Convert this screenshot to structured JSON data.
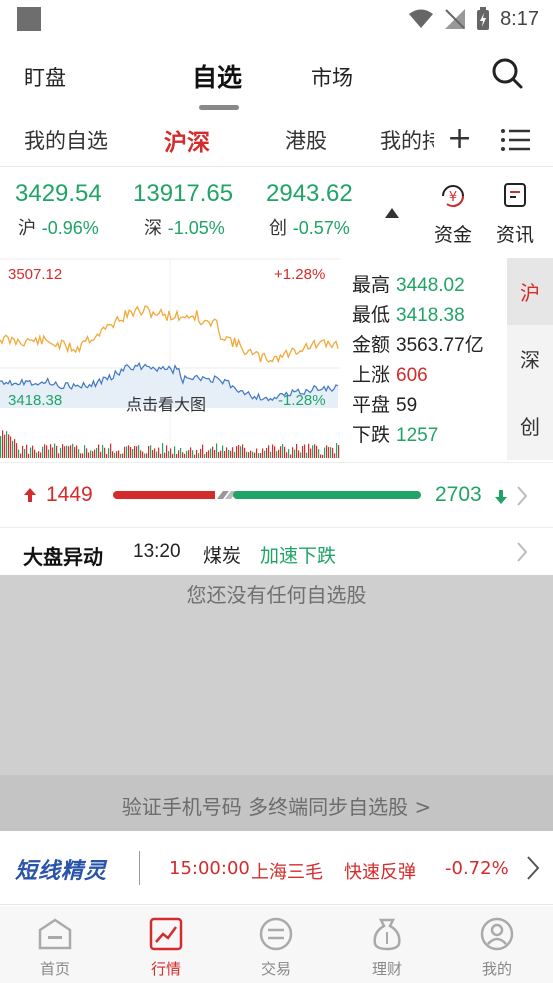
{
  "status_bar": {
    "time": "8:17"
  },
  "top_nav": {
    "left": "盯盘",
    "center": "自选",
    "market": "市场"
  },
  "sub_tabs": {
    "my_watchlist": "我的自选",
    "hs": "沪深",
    "hk": "港股",
    "my_holdings": "我的持仓",
    "plus": "+"
  },
  "indices": [
    {
      "value": "3429.54",
      "name": "沪",
      "change": "-0.96%"
    },
    {
      "value": "13917.65",
      "name": "深",
      "change": "-1.05%"
    },
    {
      "value": "2943.62",
      "name": "创",
      "change": "-0.57%"
    }
  ],
  "actions": {
    "funds": "资金",
    "news": "资讯",
    "funds_icon_char": "¥"
  },
  "chart": {
    "high_label": "3507.12",
    "low_label": "3418.38",
    "up_pct": "+1.28%",
    "down_pct": "-1.28%",
    "overlay_hint": "点击看大图"
  },
  "stats": [
    {
      "key": "最高",
      "value": "3448.02",
      "color": "#20a466"
    },
    {
      "key": "最低",
      "value": "3418.38",
      "color": "#20a466"
    },
    {
      "key": "金额",
      "value": "3563.77亿",
      "color": "#222222"
    },
    {
      "key": "上涨",
      "value": "606",
      "color": "#d42b2b"
    },
    {
      "key": "平盘",
      "value": "59",
      "color": "#222222"
    },
    {
      "key": "下跌",
      "value": "1257",
      "color": "#20a466"
    }
  ],
  "market_tabs": [
    "沪",
    "深",
    "创"
  ],
  "breadth": {
    "up": "1449",
    "down": "2703"
  },
  "alert": {
    "title": "大盘异动",
    "time": "13:20",
    "sector": "煤炭",
    "action": "加速下跌"
  },
  "empty": {
    "message": "您还没有任何自选股",
    "verify": "验证手机号码 多终端同步自选股 >"
  },
  "ticker": {
    "brand": "短线精灵",
    "time": "15:00:00",
    "stock": "上海三毛",
    "event": "快速反弹",
    "change": "-0.72%"
  },
  "bottom_nav": [
    {
      "label": "首页",
      "icon": "home-icon"
    },
    {
      "label": "行情",
      "icon": "chart-icon"
    },
    {
      "label": "交易",
      "icon": "trade-icon"
    },
    {
      "label": "理财",
      "icon": "wealth-icon"
    },
    {
      "label": "我的",
      "icon": "profile-icon"
    }
  ],
  "colors": {
    "red": "#d42b2b",
    "green": "#20a466",
    "accent_blue": "#2a54a8"
  }
}
